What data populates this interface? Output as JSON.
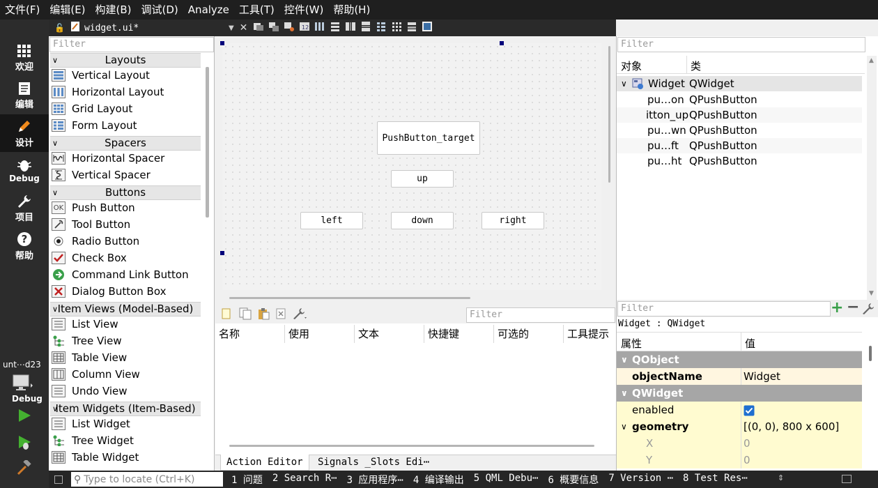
{
  "menu": [
    "文件(F)",
    "编辑(E)",
    "构建(B)",
    "调试(D)",
    "Analyze",
    "工具(T)",
    "控件(W)",
    "帮助(H)"
  ],
  "modes": [
    {
      "label": "欢迎",
      "icon": "grid-icon"
    },
    {
      "label": "编辑",
      "icon": "document-icon"
    },
    {
      "label": "设计",
      "icon": "pencil-icon"
    },
    {
      "label": "Debug",
      "icon": "bug-icon"
    },
    {
      "label": "项目",
      "icon": "wrench-icon"
    },
    {
      "label": "帮助",
      "icon": "help-icon"
    }
  ],
  "kit": {
    "name": "unt⋯d23",
    "mode": "Debug"
  },
  "editor": {
    "filename": "widget.ui*"
  },
  "widgetbox": {
    "filter_placeholder": "Filter",
    "categories": [
      {
        "name": "Layouts",
        "items": [
          "Vertical Layout",
          "Horizontal Layout",
          "Grid Layout",
          "Form Layout"
        ]
      },
      {
        "name": "Spacers",
        "items": [
          "Horizontal Spacer",
          "Vertical Spacer"
        ]
      },
      {
        "name": "Buttons",
        "items": [
          "Push Button",
          "Tool Button",
          "Radio Button",
          "Check Box",
          "Command Link Button",
          "Dialog Button Box"
        ]
      },
      {
        "name": "Item Views (Model-Based)",
        "items": [
          "List View",
          "Tree View",
          "Table View",
          "Column View",
          "Undo View"
        ]
      },
      {
        "name": "Item Widgets (Item-Based)",
        "items": [
          "List Widget",
          "Tree Widget",
          "Table Widget"
        ]
      }
    ]
  },
  "form": {
    "buttons": {
      "target": "PushButton_target",
      "up": "up",
      "left": "left",
      "down": "down",
      "right": "right"
    }
  },
  "action_editor": {
    "filter_placeholder": "Filter",
    "columns": [
      "名称",
      "使用",
      "文本",
      "快捷键",
      "可选的",
      "工具提示"
    ],
    "tabs": [
      "Action Editor",
      "Signals _Slots Edi⋯"
    ]
  },
  "object_inspector": {
    "filter_placeholder": "Filter",
    "headers": [
      "对象",
      "类"
    ],
    "root": {
      "object": "Widget",
      "class": "QWidget"
    },
    "children": [
      {
        "object": "pu…on",
        "class": "QPushButton"
      },
      {
        "object": "itton_up",
        "class": "QPushButton"
      },
      {
        "object": "pu…wn",
        "class": "QPushButton"
      },
      {
        "object": "pu…ft",
        "class": "QPushButton"
      },
      {
        "object": "pu…ht",
        "class": "QPushButton"
      }
    ]
  },
  "property_editor": {
    "filter_placeholder": "Filter",
    "context": "Widget : QWidget",
    "headers": [
      "属性",
      "值"
    ],
    "sections": {
      "qobject": "QObject",
      "objectname_name": "objectName",
      "objectname_value": "Widget",
      "qwidget": "QWidget",
      "enabled_name": "enabled",
      "geometry_name": "geometry",
      "geometry_value": "[(0, 0), 800 x 600]",
      "x_name": "X",
      "x_value": "0",
      "y_name": "Y",
      "y_value": "0"
    }
  },
  "statusbar": {
    "locate_placeholder": "Type to locate (Ctrl+K)",
    "outputs": [
      "1 问题",
      "2 Search R⋯",
      "3 应用程序⋯",
      "4 编译输出",
      "5 QML Debu⋯",
      "6 概要信息",
      "7 Version ⋯",
      "8 Test Res⋯"
    ]
  },
  "colors": {
    "menubar": "#1f1f1f",
    "modebar": "#2c2c2c",
    "run_green": "#44b030",
    "category_gray": "#a6a6a6",
    "property_highlight": "#fff6e0",
    "property_yellow": "#fffbd0"
  }
}
